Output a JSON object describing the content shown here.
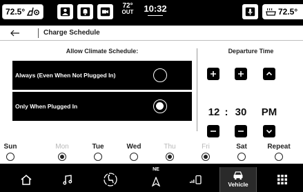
{
  "status_bar": {
    "left_temp": "72.5°",
    "outside_temp": "72°",
    "outside_label": "OUT",
    "time": "10:32",
    "right_temp": "72.5°"
  },
  "header": {
    "title": "Charge Schedule"
  },
  "climate": {
    "label": "Allow Climate Schedule:",
    "options": [
      {
        "label": "Always (Even When Not Plugged In)",
        "selected": false
      },
      {
        "label": "Only When Plugged In",
        "selected": true
      }
    ]
  },
  "departure": {
    "label": "Departure Time",
    "hour": "12",
    "separator": ":",
    "minute": "30",
    "period": "PM"
  },
  "days": [
    {
      "label": "Sun",
      "checked": false,
      "dim": false
    },
    {
      "label": "Mon",
      "checked": true,
      "dim": true
    },
    {
      "label": "Tue",
      "checked": false,
      "dim": false
    },
    {
      "label": "Wed",
      "checked": false,
      "dim": false
    },
    {
      "label": "Thu",
      "checked": true,
      "dim": true
    },
    {
      "label": "Fri",
      "checked": true,
      "dim": true
    },
    {
      "label": "Sat",
      "checked": false,
      "dim": false
    },
    {
      "label": "Repeat",
      "checked": false,
      "dim": false
    }
  ],
  "bottom_nav": {
    "nav_direction": "NE",
    "vehicle_label": "Vehicle"
  },
  "icons": {
    "seat_heat": "seat-heat-icon",
    "driver": "driver-profile-icon",
    "notification": "notification-bell-icon",
    "camera": "camera-icon",
    "microphone": "microphone-icon",
    "heated_wheel": "heated-wheel-icon",
    "back": "back-arrow-icon",
    "home": "home-icon",
    "media": "music-note-icon",
    "comfort": "comfort-icon",
    "navigation": "navigation-arrow-icon",
    "phone": "phone-signal-icon",
    "vehicle": "vehicle-icon",
    "apps": "apps-grid-icon"
  }
}
